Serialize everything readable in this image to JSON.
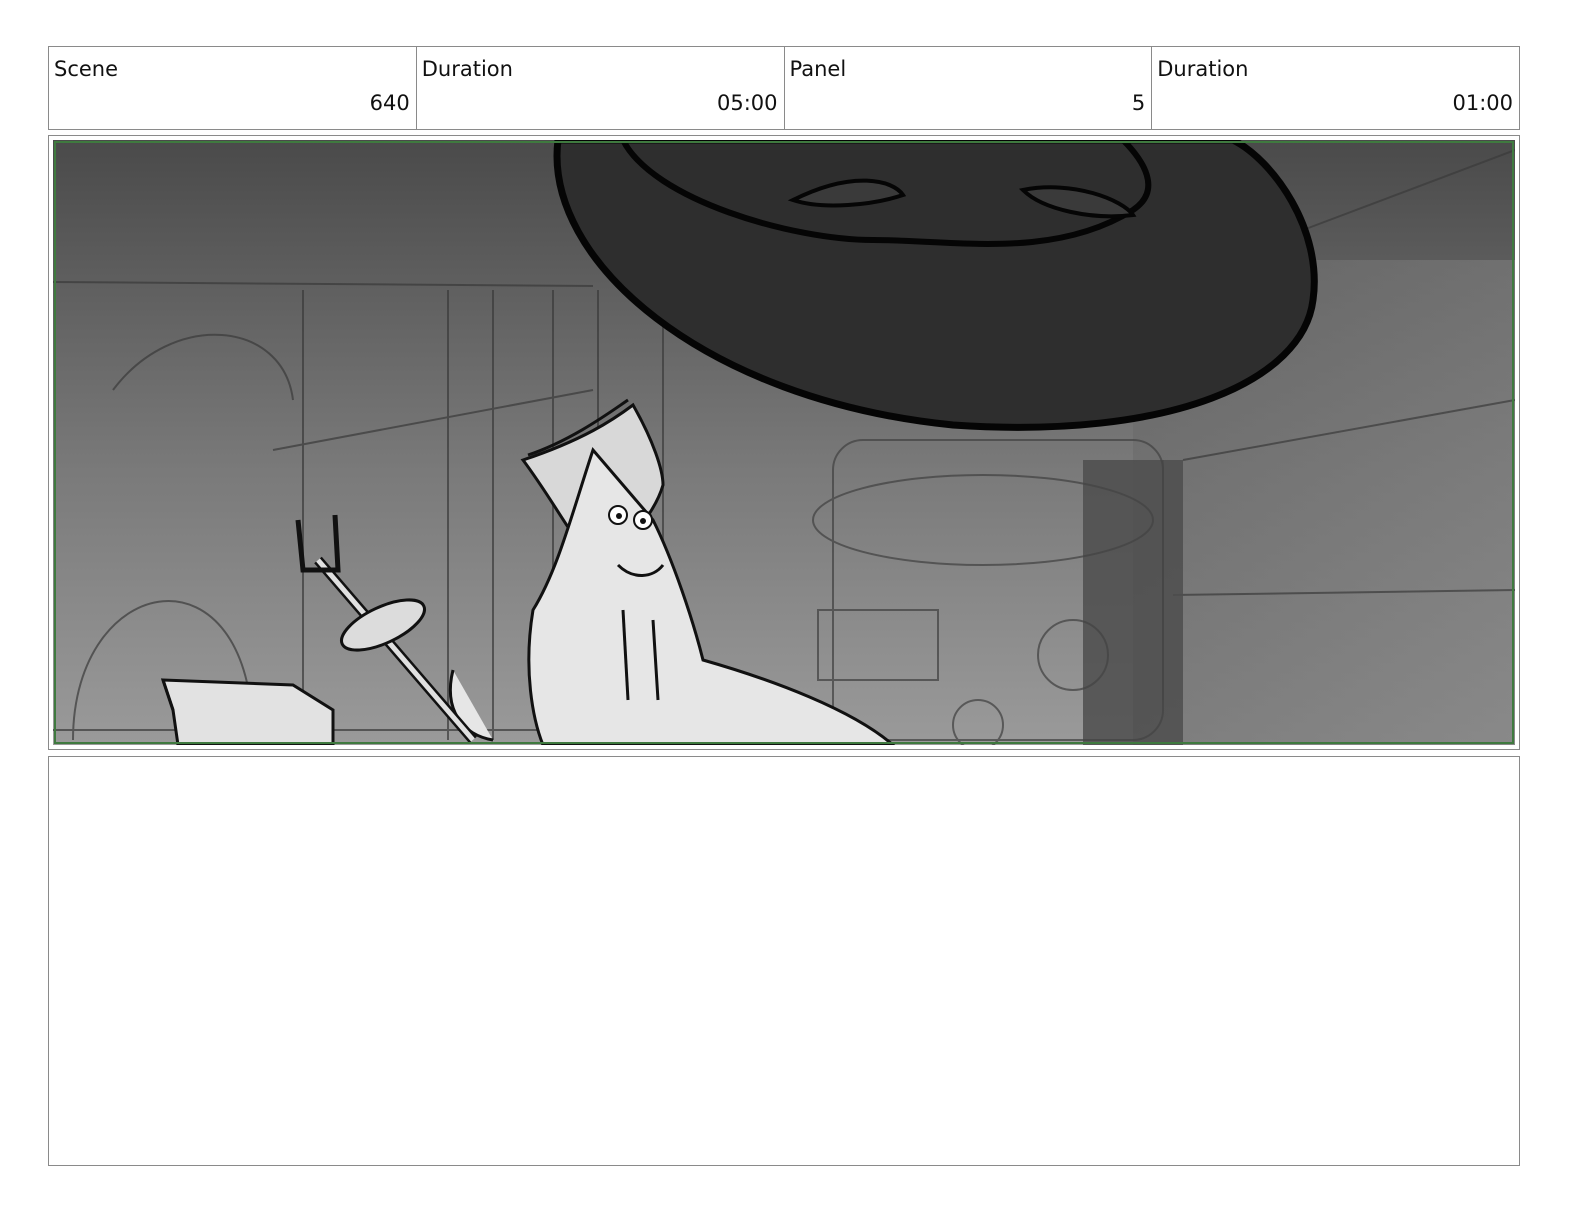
{
  "header": {
    "scene_label": "Scene",
    "scene_value": "640",
    "scene_duration_label": "Duration",
    "scene_duration_value": "05:00",
    "panel_label": "Panel",
    "panel_value": "5",
    "panel_duration_label": "Duration",
    "panel_duration_value": "01:00"
  },
  "colors": {
    "frame_border": "#3f7a3f",
    "table_border": "#8a8a8a"
  }
}
